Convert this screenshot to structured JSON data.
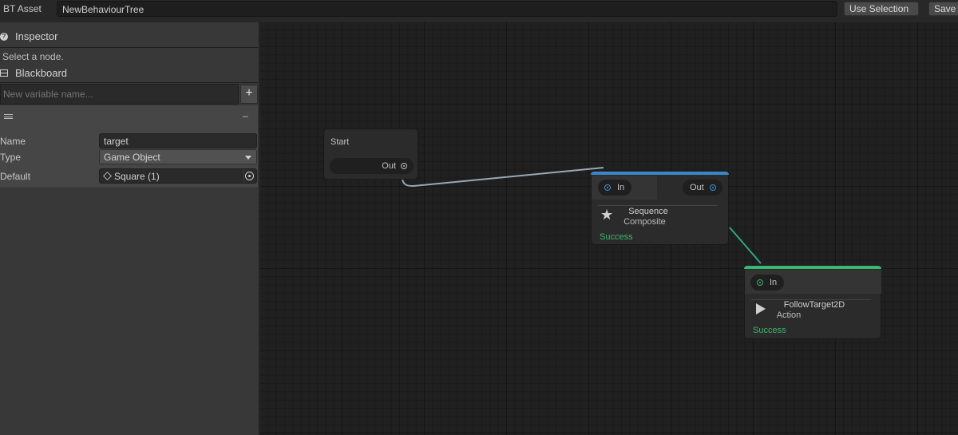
{
  "toolbar": {
    "asset_label": "BT Asset",
    "asset_name": "NewBehaviourTree",
    "use_selection": "Use Selection",
    "save": "Save"
  },
  "inspector": {
    "title": "Inspector",
    "hint": "Select a node."
  },
  "blackboard": {
    "title": "Blackboard",
    "new_var_placeholder": "New variable name...",
    "add_button": "+",
    "variable": {
      "remove": "–",
      "name_label": "Name",
      "name_value": "target",
      "type_label": "Type",
      "type_value": "Game Object",
      "default_label": "Default",
      "default_value": "Square (1)"
    }
  },
  "graph": {
    "nodes": {
      "start": {
        "title": "Start",
        "out_label": "Out"
      },
      "sequence": {
        "in_label": "In",
        "out_label": "Out",
        "name": "Sequence",
        "type": "Composite",
        "status": "Success",
        "accent": "#3a86c8"
      },
      "follow": {
        "in_label": "In",
        "name": "FollowTarget2D",
        "type": "Action",
        "status": "Success",
        "accent": "#3ab86d"
      }
    }
  }
}
